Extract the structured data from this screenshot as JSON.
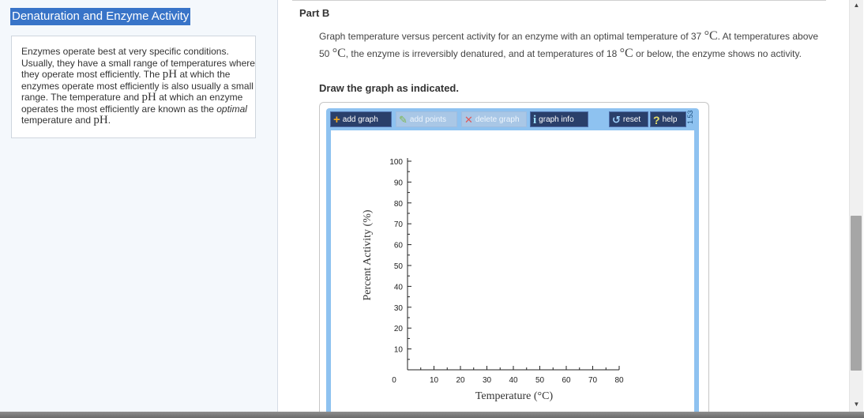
{
  "module": {
    "title": "Denaturation and Enzyme Activity"
  },
  "intro": {
    "text_before_ph1": "Enzymes operate best at very specific conditions. Usually, they have a small range of temperatures where they operate most efficiently. The ",
    "ph": "pH",
    "text_mid1": " at which the enzymes operate most efficiently is also usually a small range. The temperature and ",
    "text_mid2": " at which an enzyme operates the most efficiently are known as the ",
    "optimal": "optimal",
    "text_end": " temperature and ",
    "period": "."
  },
  "part": {
    "title": "Part B"
  },
  "question": {
    "t1": "Graph temperature versus percent activity for an enzyme with an optimal temperature of 37 ",
    "deg_c": "°C",
    "t2": ". At temperatures above 50 ",
    "t3": ", the enzyme is irreversibly denatured, and at temperatures of 18 ",
    "t4": " or below, the enzyme shows no activity."
  },
  "instruction": "Draw the graph as indicated.",
  "toolbar": {
    "add_graph": "add graph",
    "add_points": "add points",
    "delete_graph": "delete graph",
    "graph_info": "graph info",
    "reset": "reset",
    "help": "help",
    "version": "1.53"
  },
  "icons": {
    "add": "plus-icon",
    "points": "pencil-icon",
    "delete": "x-icon",
    "info": "info-icon",
    "reset": "reset-arrow-icon",
    "help": "question-icon"
  },
  "graph": {
    "x_label": "Temperature (°C)",
    "y_label": "Percent Activity (%)",
    "x_ticks": [
      "0",
      "10",
      "20",
      "30",
      "40",
      "50",
      "60",
      "70",
      "80"
    ],
    "y_ticks": [
      "10",
      "20",
      "30",
      "40",
      "50",
      "60",
      "70",
      "80",
      "90",
      "100"
    ],
    "x_range": [
      0,
      80
    ],
    "y_range": [
      0,
      100
    ]
  }
}
